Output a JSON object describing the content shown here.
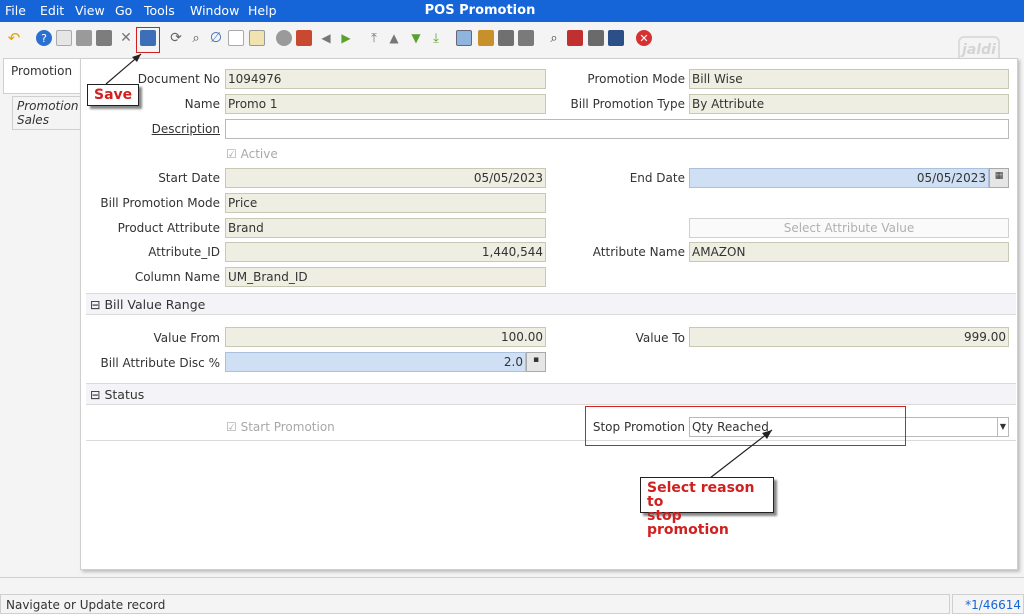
{
  "menu": {
    "file": "File",
    "edit": "Edit",
    "view": "View",
    "go": "Go",
    "tools": "Tools",
    "window": "Window",
    "help": "Help"
  },
  "app_title": "POS Promotion",
  "logo_text": "jaldi",
  "tabs": {
    "promotion": "Promotion",
    "promotion_sales_line1": "Promotion",
    "promotion_sales_line2": "Sales"
  },
  "form": {
    "document_no_label": "Document No",
    "document_no": "1094976",
    "promotion_mode_label": "Promotion Mode",
    "promotion_mode": "Bill Wise",
    "name_label": "Name",
    "name": "Promo 1",
    "bill_promotion_type_label": "Bill Promotion Type",
    "bill_promotion_type": "By Attribute",
    "description_label": "Description",
    "description": "",
    "active_label": "Active",
    "start_date_label": "Start Date",
    "start_date": "05/05/2023",
    "end_date_label": "End Date",
    "end_date": "05/05/2023",
    "bill_promotion_mode_label": "Bill Promotion Mode",
    "bill_promotion_mode": "Price",
    "product_attribute_label": "Product Attribute",
    "product_attribute": "Brand",
    "select_attribute_value": "Select Attribute Value",
    "attribute_id_label": "Attribute_ID",
    "attribute_id": "1,440,544",
    "attribute_name_label": "Attribute Name",
    "attribute_name": "AMAZON",
    "column_name_label": "Column Name",
    "column_name": "UM_Brand_ID"
  },
  "bill_value_range": {
    "title": "Bill Value Range",
    "value_from_label": "Value From",
    "value_from": "100.00",
    "value_to_label": "Value To",
    "value_to": "999.00",
    "bill_attribute_disc_label": "Bill Attribute Disc %",
    "bill_attribute_disc": "2.0"
  },
  "status_section": {
    "title": "Status",
    "start_promotion_label": "Start Promotion",
    "stop_promotion_label": "Stop Promotion",
    "stop_promotion_value": "Qty Reached"
  },
  "annotations": {
    "save": "Save",
    "select_reason_line1": "Select reason to",
    "select_reason_line2": "stop promotion"
  },
  "statusbar": {
    "message": "Navigate or Update record",
    "record": "*1/46614"
  },
  "colors": {
    "menubar": "#1565d8",
    "annotation_red": "#d02020",
    "readonly_field": "#eeeee2",
    "mandatory_field": "#cfe0f5"
  }
}
